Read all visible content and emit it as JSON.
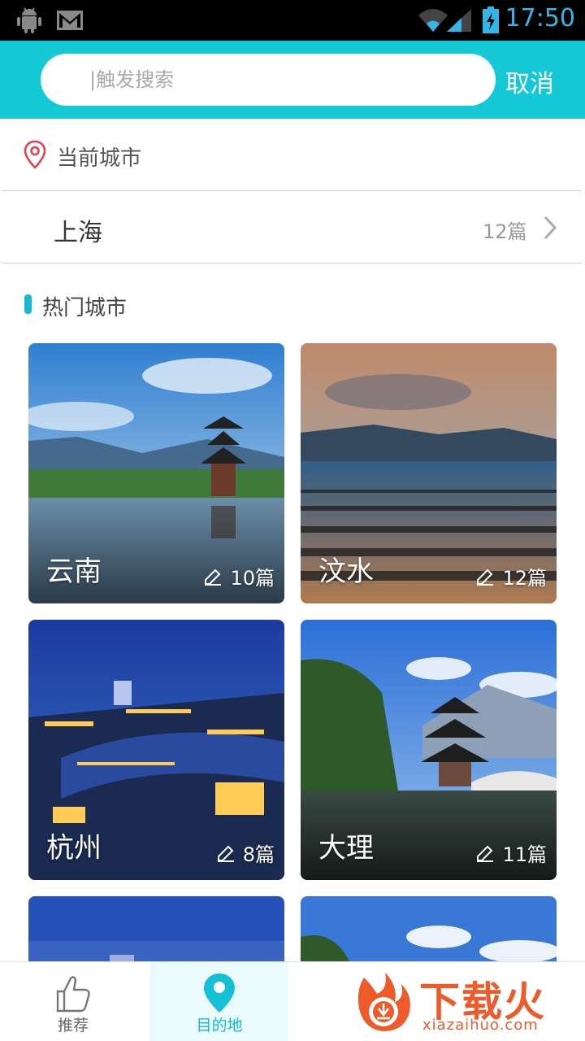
{
  "status_bar": {
    "time": "17:50",
    "icons": [
      "android-icon",
      "gmail-icon",
      "wifi-icon",
      "signal-icon",
      "battery-icon"
    ]
  },
  "search": {
    "placeholder": "|触发搜索",
    "cancel_label": "取消"
  },
  "current_city": {
    "section_label": "当前城市",
    "city": "上海",
    "count": "12篇"
  },
  "hot_cities": {
    "section_label": "热门城市",
    "cards": [
      {
        "name": "云南",
        "count": "10篇"
      },
      {
        "name": "汶水",
        "count": "12篇"
      },
      {
        "name": "杭州",
        "count": "8篇"
      },
      {
        "name": "大理",
        "count": "11篇"
      }
    ]
  },
  "bottom_nav": {
    "items": [
      {
        "label": "推荐",
        "icon": "thumbs-up-icon"
      },
      {
        "label": "目的地",
        "icon": "location-pin-icon",
        "active": true
      }
    ]
  },
  "watermark": {
    "title": "下载火",
    "url": "xiazaihuo.com"
  },
  "colors": {
    "accent": "#14c8d6",
    "status_time": "#33b5e5",
    "watermark": "#ee5a2a"
  }
}
